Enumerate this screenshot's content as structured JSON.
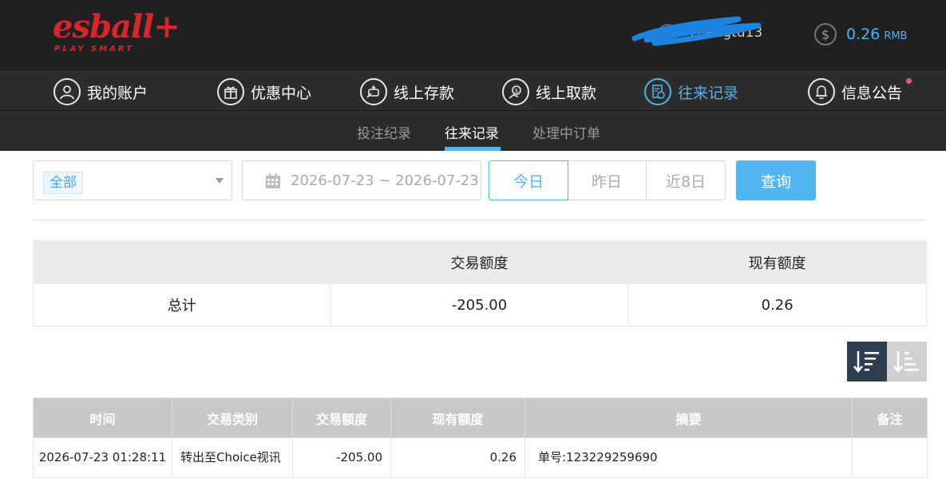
{
  "brand": {
    "name": "esball+",
    "slogan": "PLAY SMART"
  },
  "user": {
    "username": "chengtu13"
  },
  "balance": {
    "amount": "0.26",
    "unit": "RMB",
    "icon": "dollar-icon"
  },
  "main_nav": [
    {
      "label": "我的账户",
      "icon": "user-icon"
    },
    {
      "label": "优惠中心",
      "icon": "gift-icon"
    },
    {
      "label": "线上存款",
      "icon": "deposit-icon"
    },
    {
      "label": "线上取款",
      "icon": "withdraw-icon"
    },
    {
      "label": "往来记录",
      "icon": "record-icon",
      "active": true
    },
    {
      "label": "信息公告",
      "icon": "bell-icon"
    }
  ],
  "sub_nav": [
    {
      "label": "投注纪录"
    },
    {
      "label": "往来记录",
      "active": true
    },
    {
      "label": "处理中订单"
    }
  ],
  "filter": {
    "type_selected": "全部",
    "date_range": "2026-07-23 ~ 2026-07-23",
    "quick_ranges": [
      "今日",
      "昨日",
      "近8日"
    ],
    "active_range": "今日",
    "query_label": "查询"
  },
  "summary": {
    "headers": [
      "",
      "交易额度",
      "现有额度"
    ],
    "row": {
      "label": "总计",
      "amount": "-205.00",
      "balance": "0.26"
    }
  },
  "records": {
    "headers": [
      "时间",
      "交易类别",
      "交易额度",
      "现有额度",
      "摘要",
      "备注"
    ],
    "rows": [
      {
        "time": "2026-07-23 01:28:11",
        "category": "转出至Choice视讯",
        "amount": "-205.00",
        "balance": "0.26",
        "summary": "单号:123229259690",
        "note": ""
      }
    ]
  },
  "colors": {
    "accent": "#4fb4f0",
    "brand_red": "#d6262c",
    "header_bg": "#202020",
    "nav_bg": "#2c2c2c"
  }
}
